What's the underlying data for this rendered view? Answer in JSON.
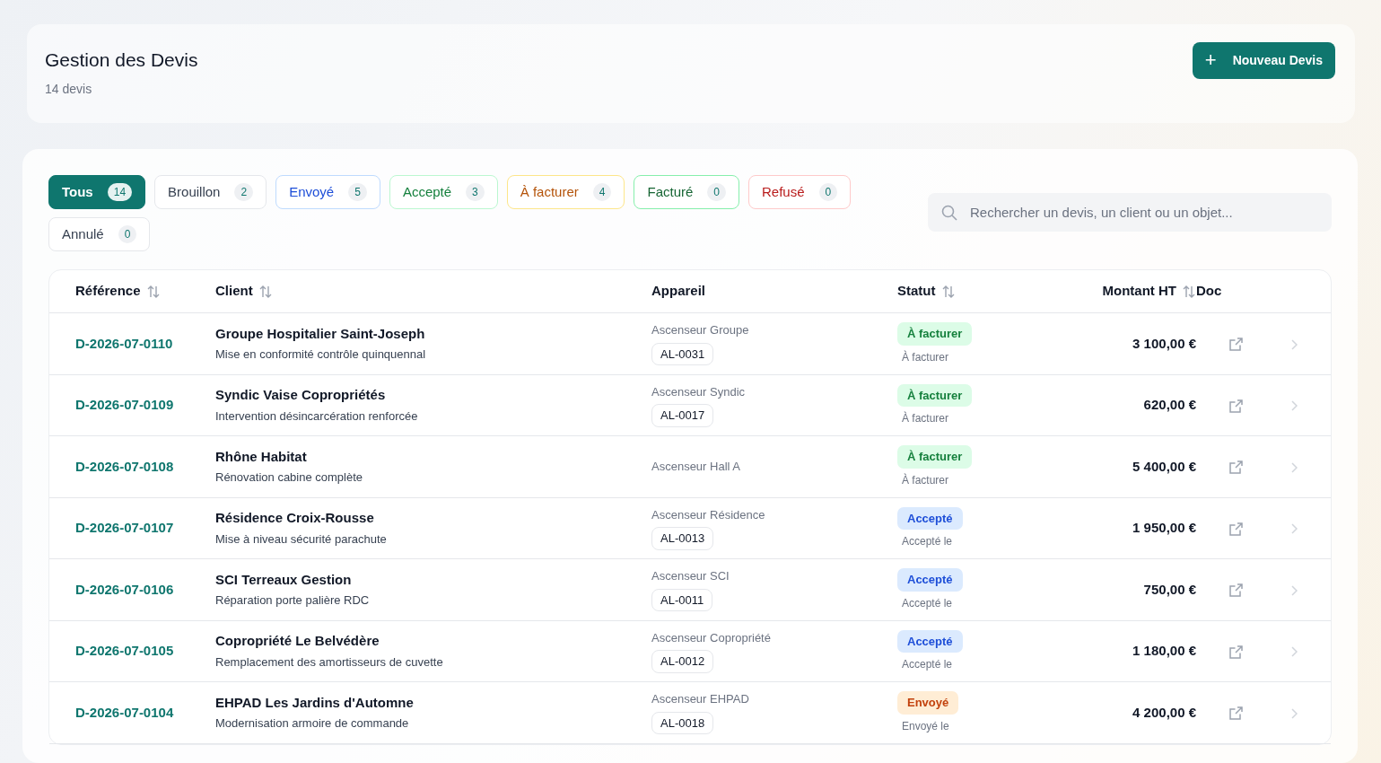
{
  "header": {
    "title": "Gestion des Devis",
    "subtitle": "14 devis",
    "new_button": {
      "icon": "+",
      "label": "Nouveau Devis"
    }
  },
  "filters": [
    {
      "label": "Tous",
      "count": "14",
      "kind": "all",
      "selected": true
    },
    {
      "label": "Brouillon",
      "count": "2",
      "kind": "draft",
      "selected": false
    },
    {
      "label": "Envoyé",
      "count": "5",
      "kind": "sent",
      "selected": false
    },
    {
      "label": "Accepté",
      "count": "3",
      "kind": "accepted",
      "selected": false
    },
    {
      "label": "À facturer",
      "count": "4",
      "kind": "to_invoice",
      "selected": false
    },
    {
      "label": "Facturé",
      "count": "0",
      "kind": "invoiced",
      "selected": false
    },
    {
      "label": "Refusé",
      "count": "0",
      "kind": "refused",
      "selected": false
    },
    {
      "label": "Annulé",
      "count": "0",
      "kind": "cancelled",
      "selected": false
    }
  ],
  "search": {
    "placeholder": "Rechercher un devis, un client ou un objet..."
  },
  "table": {
    "columns": [
      {
        "label": "Référence",
        "sortable": true
      },
      {
        "label": "Client",
        "sortable": true
      },
      {
        "label": "Appareil",
        "sortable": false
      },
      {
        "label": "Statut",
        "sortable": true
      },
      {
        "label": "Montant HT",
        "sortable": true
      },
      {
        "label": "Doc",
        "sortable": false
      }
    ],
    "rows": [
      {
        "reference": "D-2026-07-0110",
        "client": "Groupe Hospitalier Saint-Joseph",
        "object": "Mise en conformité contrôle quinquennal",
        "device": "Ascenseur Groupe",
        "device_code": "AL-0031",
        "status": "À facturer",
        "kind": "to_invoice",
        "status_note": "À facturer",
        "amount": "3 100,00 €"
      },
      {
        "reference": "D-2026-07-0109",
        "client": "Syndic Vaise Copropriétés",
        "object": "Intervention désincarcération renforcée",
        "device": "Ascenseur Syndic",
        "device_code": "AL-0017",
        "status": "À facturer",
        "kind": "to_invoice",
        "status_note": "À facturer",
        "amount": "620,00 €"
      },
      {
        "reference": "D-2026-07-0108",
        "client": "Rhône Habitat",
        "object": "Rénovation cabine complète",
        "device": "Ascenseur Hall A",
        "status": "À facturer",
        "kind": "to_invoice",
        "status_note": "À facturer",
        "amount": "5 400,00 €"
      },
      {
        "reference": "D-2026-07-0107",
        "client": "Résidence Croix-Rousse",
        "object": "Mise à niveau sécurité parachute",
        "device": "Ascenseur Résidence",
        "device_code": "AL-0013",
        "status": "Accepté",
        "kind": "accepted",
        "status_note": "Accepté le",
        "amount": "1 950,00 €"
      },
      {
        "reference": "D-2026-07-0106",
        "client": "SCI Terreaux Gestion",
        "object": "Réparation porte palière RDC",
        "device": "Ascenseur SCI",
        "device_code": "AL-0011",
        "status": "Accepté",
        "kind": "accepted",
        "status_note": "Accepté le",
        "amount": "750,00 €"
      },
      {
        "reference": "D-2026-07-0105",
        "client": "Copropriété Le Belvédère",
        "object": "Remplacement des amortisseurs de cuvette",
        "device": "Ascenseur Copropriété",
        "device_code": "AL-0012",
        "status": "Accepté",
        "kind": "accepted",
        "status_note": "Accepté le",
        "amount": "1 180,00 €"
      },
      {
        "reference": "D-2026-07-0104",
        "client": "EHPAD Les Jardins d'Automne",
        "object": "Modernisation armoire de commande",
        "device": "Ascenseur EHPAD",
        "device_code": "AL-0018",
        "status": "Envoyé",
        "kind": "sent",
        "status_note": "Envoyé le",
        "amount": "4 200,00 €"
      }
    ]
  }
}
